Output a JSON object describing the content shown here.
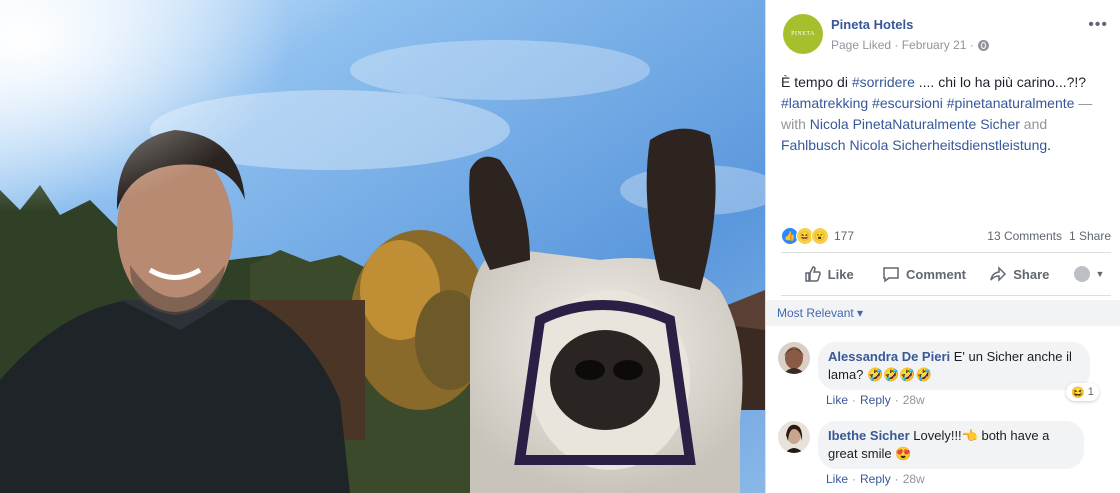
{
  "page": {
    "name": "Pineta Hotels",
    "logo_text": "PINETA",
    "meta": "Page Liked · February 21 ·",
    "more": "•••"
  },
  "post": {
    "text_start": "È tempo di ",
    "hashtag1": "#sorridere",
    "text_mid": " .... chi lo ha più carino...?!? ",
    "hashtag2": "#lamatrekking",
    "hashtag3": "#escursioni",
    "hashtag4": "#pinetanaturalmente",
    "text_with": " — with ",
    "person1": "Nicola PinetaNaturalmente Sicher",
    "text_and": " and ",
    "person2": "Fahlbusch Nicola Sicherheitsdienstleistung",
    "text_end": "."
  },
  "reactions": {
    "count": "177",
    "comments": "13 Comments",
    "shares": "1 Share"
  },
  "actions": {
    "like": "Like",
    "comment": "Comment",
    "share": "Share"
  },
  "sort": "Most Relevant ▾",
  "comments": [
    {
      "name": "Alessandra De Pieri",
      "text": " E' un Sicher anche il lama? 🤣🤣🤣🤣",
      "like": "Like",
      "reply": "Reply",
      "time": "28w",
      "reaction_count": "1"
    },
    {
      "name": "Ibethe Sicher",
      "text": " Lovely!!!👈 both have a great smile 😍",
      "like": "Like",
      "reply": "Reply",
      "time": "28w"
    }
  ],
  "colors": {
    "link": "#365899",
    "brand": "#a6bf2c",
    "sky": "#5b9be0"
  },
  "icons": [
    "globe-icon",
    "like-icon",
    "comment-icon",
    "share-icon",
    "avatar-dropdown-icon"
  ]
}
